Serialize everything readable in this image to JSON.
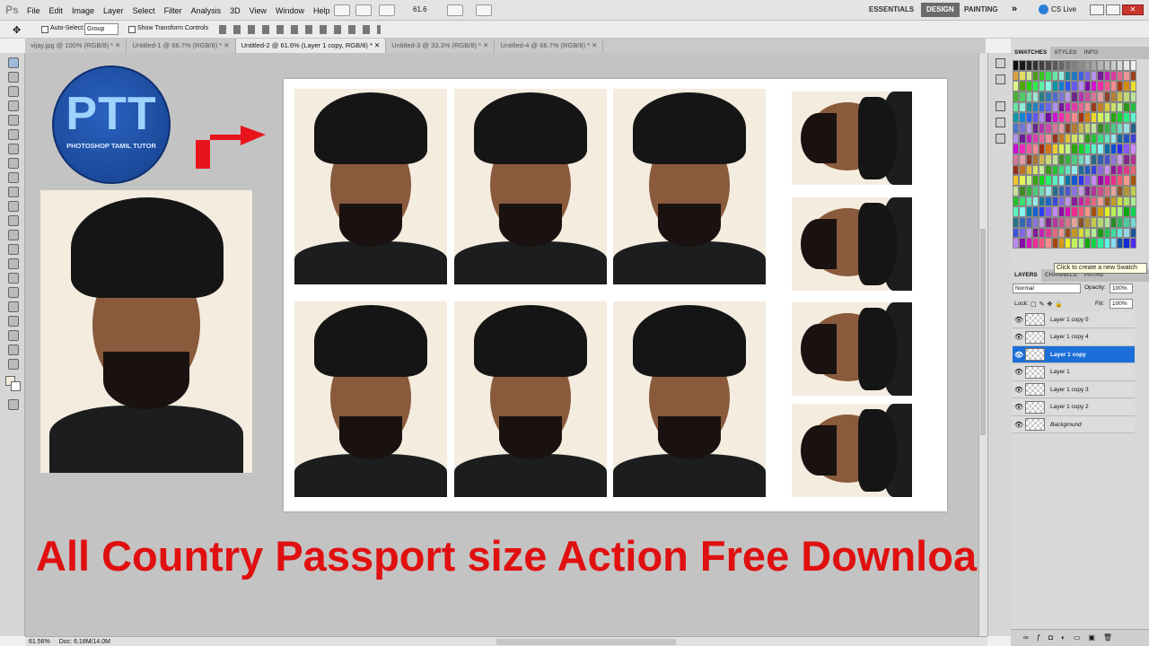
{
  "app": {
    "logo": "Ps"
  },
  "menu": [
    "File",
    "Edit",
    "Image",
    "Layer",
    "Select",
    "Filter",
    "Analysis",
    "3D",
    "View",
    "Window",
    "Help"
  ],
  "appbar": {
    "zoom": "61.6",
    "workspaces": [
      "ESSENTIALS",
      "DESIGN",
      "PAINTING"
    ],
    "active_workspace": "DESIGN",
    "more": "»",
    "cslive": "CS Live"
  },
  "options": {
    "auto_select_label": "Auto-Select:",
    "auto_select_value": "Group",
    "transform_label": "Show Transform Controls"
  },
  "tabs": [
    {
      "label": "vijay.jpg @ 100% (RGB/8) *",
      "active": false
    },
    {
      "label": "Untitled-1 @ 66.7% (RGB/8) *",
      "active": false
    },
    {
      "label": "Untitled-2 @ 61.6% (Layer 1 copy, RGB/8) *",
      "active": true
    },
    {
      "label": "Untitled-3 @ 33.3% (RGB/8) *",
      "active": false
    },
    {
      "label": "Untitled-4 @ 66.7% (RGB/8) *",
      "active": false
    }
  ],
  "status": {
    "zoom": "61.56%",
    "doc": "Doc: 6.18M/14.0M"
  },
  "logo": {
    "big": "PTT",
    "small": "PHOTOSHOP TAMIL TUTOR"
  },
  "headline": "All Country Passport size Action Free Download",
  "swatches_panel": {
    "tabs": [
      "SWATCHES",
      "STYLES",
      "INFO"
    ],
    "active_tab": "SWATCHES",
    "tooltip": "Click to create a new Swatch"
  },
  "layers_panel": {
    "tabs": [
      "LAYERS",
      "CHANNELS",
      "PATHS"
    ],
    "blend_mode": "Normal",
    "opacity_label": "Opacity:",
    "opacity": "100%",
    "lock_label": "Lock:",
    "fill_label": "Fill:",
    "fill": "100%",
    "layers": [
      {
        "name": "Layer 1 copy 5",
        "selected": false
      },
      {
        "name": "Layer 1 copy 4",
        "selected": false
      },
      {
        "name": "Layer 1 copy",
        "selected": true
      },
      {
        "name": "Layer 1",
        "selected": false
      },
      {
        "name": "Layer 1 copy 3",
        "selected": false
      },
      {
        "name": "Layer 1 copy 2",
        "selected": false
      },
      {
        "name": "Background",
        "selected": false
      }
    ]
  },
  "colors": {
    "headline": "#e01010",
    "selection": "#1c6fd8",
    "arrow": "#e8141c",
    "canvas": "#c3c3c3"
  }
}
